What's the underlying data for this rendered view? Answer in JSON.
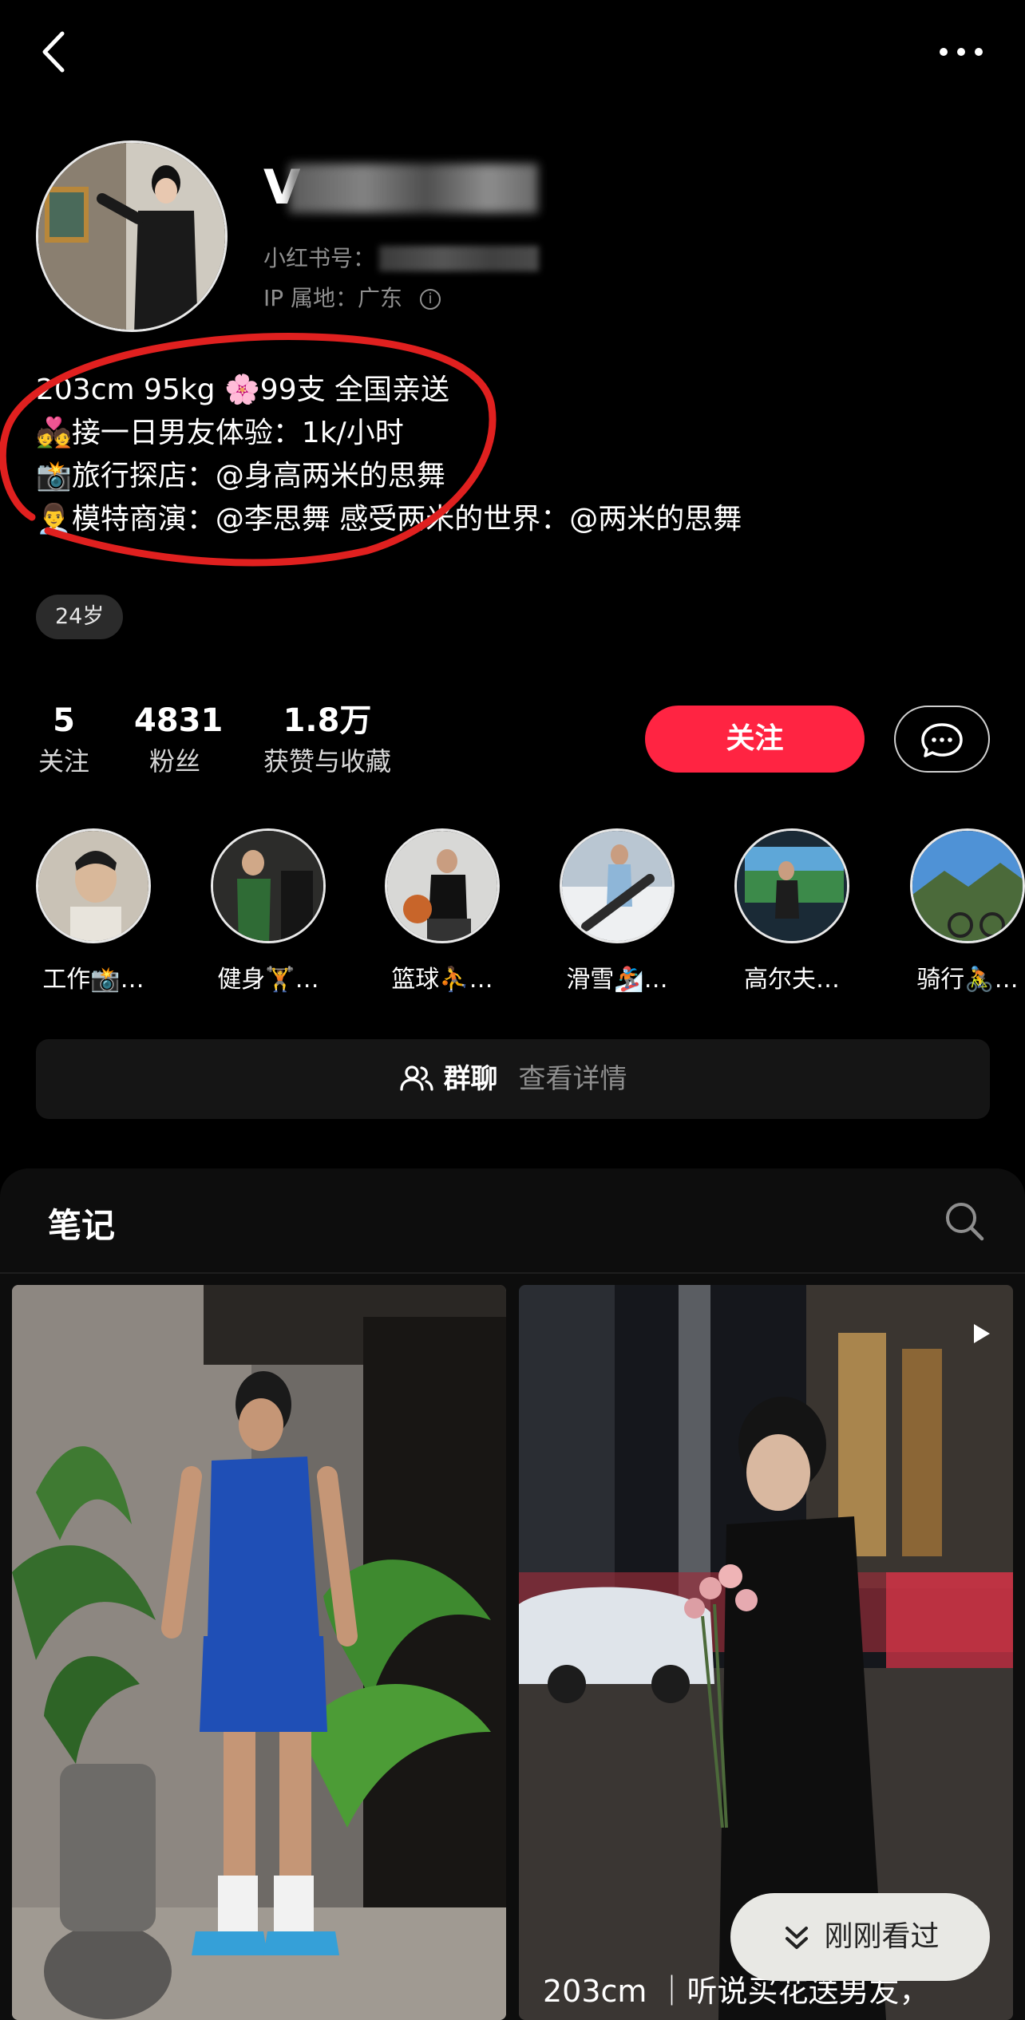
{
  "header": {
    "back_icon": "back-chevron-icon",
    "more_icon": "more-dots-icon"
  },
  "profile": {
    "name_prefix": "V",
    "redbook_id_label": "小红书号：",
    "ip_label": "IP 属地：广东",
    "ip_info_icon": "info-icon",
    "bio_lines": [
      "203cm 95kg 🌸99支 全国亲送",
      "💑接一日男友体验：1k/小时",
      "📸旅行探店：@身高两米的思舞",
      "👨‍💼模特商演：@李思舞 感受两米的世界：@两米的思舞"
    ],
    "age_badge": "24岁",
    "annotation_color": "#e0201f"
  },
  "stats": [
    {
      "value": "5",
      "label": "关注"
    },
    {
      "value": "4831",
      "label": "粉丝"
    },
    {
      "value": "1.8万",
      "label": "获赞与收藏"
    }
  ],
  "actions": {
    "follow_label": "关注",
    "follow_color": "#ff2442",
    "message_icon": "chat-bubble-icon"
  },
  "highlights": [
    {
      "label": "工作📸…"
    },
    {
      "label": "健身🏋️…"
    },
    {
      "label": "篮球⛹️…"
    },
    {
      "label": "滑雪🏂…"
    },
    {
      "label": "高尔夫…"
    },
    {
      "label": "骑行🚴…"
    }
  ],
  "group_chat": {
    "icon": "group-users-icon",
    "title": "群聊",
    "link": "查看详情"
  },
  "notes": {
    "tab_title": "笔记",
    "search_icon": "search-icon",
    "cards": [
      {
        "caption": ""
      },
      {
        "caption": "203cm ｜听说买花送男友，",
        "video_icon": "play-icon"
      }
    ]
  },
  "recently_viewed": {
    "label": "刚刚看过",
    "icon": "double-chevron-down-icon"
  }
}
